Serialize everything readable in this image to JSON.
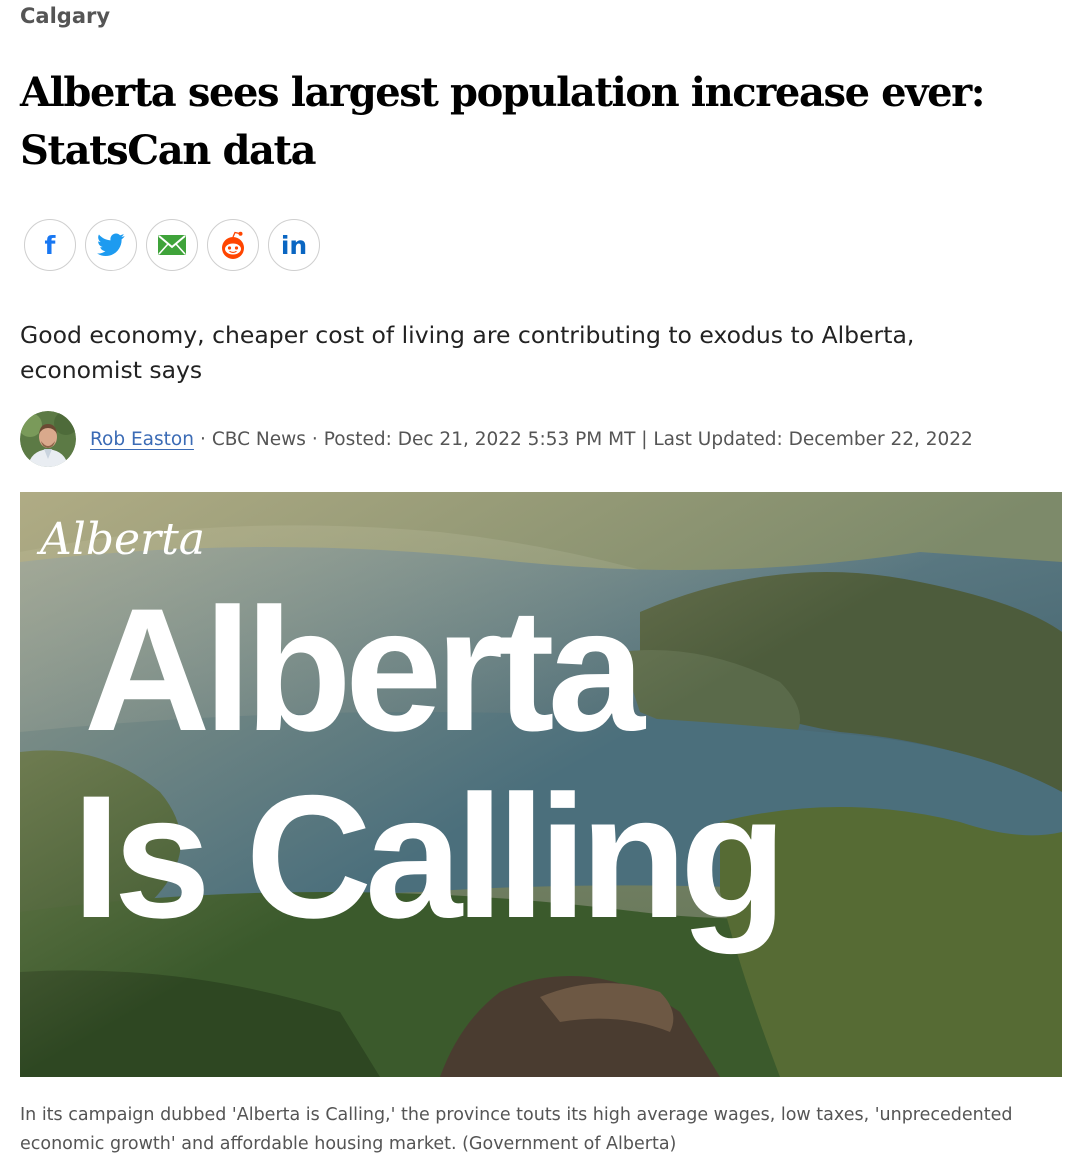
{
  "section": {
    "label": "Calgary"
  },
  "headline": "Alberta sees largest population increase ever: StatsCan data",
  "share": [
    {
      "id": "facebook",
      "icon": "facebook-icon",
      "color": "#1877f2"
    },
    {
      "id": "twitter",
      "icon": "twitter-icon",
      "color": "#1d9bf0"
    },
    {
      "id": "email",
      "icon": "email-icon",
      "color": "#3fa33a"
    },
    {
      "id": "reddit",
      "icon": "reddit-icon",
      "color": "#ff4500"
    },
    {
      "id": "linkedin",
      "icon": "linkedin-icon",
      "color": "#0a66c2"
    }
  ],
  "deck": "Good economy, cheaper cost of living are contributing to exodus to Alberta, economist says",
  "byline": {
    "author": "Rob Easton",
    "separator": "·",
    "outlet": "CBC News",
    "posted": "Posted: Dec 21, 2022 5:53 PM MT | Last Updated: December 22, 2022"
  },
  "hero": {
    "logo_text": "Alberta",
    "headline_line1": "Alberta",
    "headline_line2": "Is Calling"
  },
  "caption": "In its campaign dubbed 'Alberta is Calling,' the province touts its high average wages, low taxes, 'unprecedented economic growth' and affordable housing market. (Government of Alberta)",
  "colors": {
    "author_link": "#3b6bb5",
    "section": "#555555",
    "headline": "#000000"
  }
}
